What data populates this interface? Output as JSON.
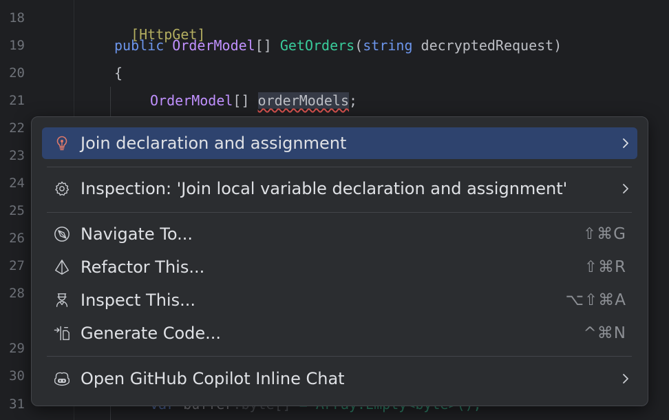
{
  "editor": {
    "line_numbers": [
      "18",
      "19",
      "20",
      "21",
      "22",
      "23",
      "24",
      "25",
      "26",
      "27",
      "28",
      "29",
      "30",
      "31"
    ],
    "lines": {
      "l18": {
        "attr": "[HttpGet]"
      },
      "l19": {
        "kw_public": "public",
        "type": "OrderModel",
        "brackets": "[] ",
        "method": "GetOrders",
        "paren_open": "(",
        "kw_string": "string",
        "param": " decryptedRequest)"
      },
      "l20": {
        "brace": "{"
      },
      "l21": {
        "type": "OrderModel",
        "brackets": "[] ",
        "var": "orderModels",
        "semicolon": ";"
      },
      "l31": {
        "kw_var": "var",
        "name": " buffer",
        "hint": ":byte[]",
        "rest": " = Array.Empty<byte>();"
      }
    }
  },
  "context_menu": {
    "items": [
      {
        "label": "Join declaration and assignment",
        "icon": "lightbulb-icon",
        "submenu": true,
        "selected": true
      },
      {
        "label": "Inspection: 'Join local variable declaration and assignment'",
        "icon": "gear-icon",
        "submenu": true
      },
      {
        "label": "Navigate To...",
        "icon": "compass-icon",
        "shortcut": "⇧⌘G"
      },
      {
        "label": "Refactor This...",
        "icon": "prism-icon",
        "shortcut": "⇧⌘R"
      },
      {
        "label": "Inspect This...",
        "icon": "inspector-icon",
        "shortcut": "⌥⇧⌘A"
      },
      {
        "label": "Generate Code...",
        "icon": "generate-code-icon",
        "shortcut": "^⌘N"
      },
      {
        "label": "Open GitHub Copilot Inline Chat",
        "icon": "copilot-icon",
        "submenu": true
      }
    ]
  },
  "colors": {
    "background": "#1e1f22",
    "popup": "#2b2d30",
    "selection": "#2e436e",
    "keyword": "#6c95eb",
    "type": "#c191ff",
    "method": "#39cc9b",
    "attribute": "#b3ae60",
    "error_underline": "#d9534f",
    "bulb": "#e07a6a"
  }
}
